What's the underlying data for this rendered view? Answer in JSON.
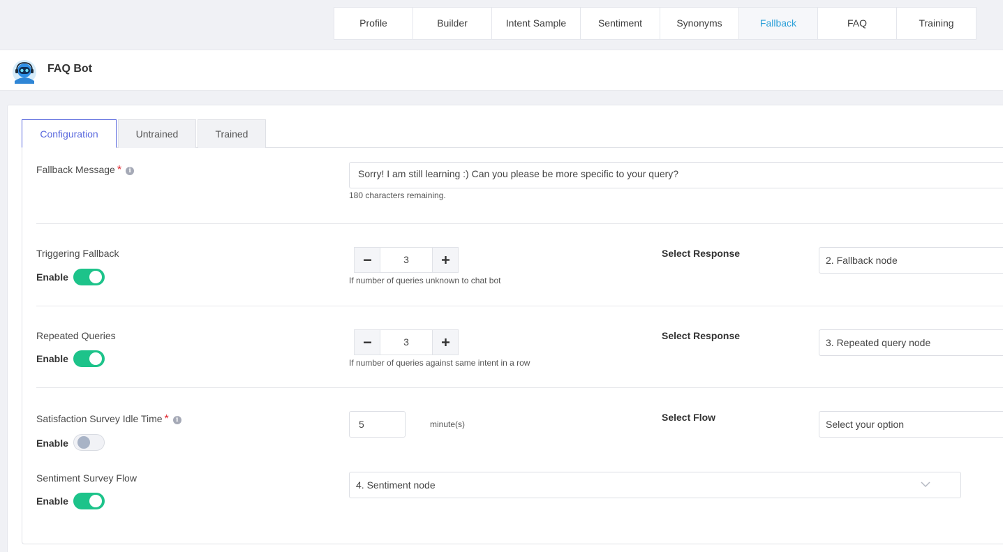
{
  "top_nav": {
    "tabs": [
      "Profile",
      "Builder",
      "Intent Sample",
      "Sentiment",
      "Synonyms",
      "Fallback",
      "FAQ",
      "Training"
    ],
    "active": "Fallback"
  },
  "header": {
    "title": "FAQ Bot",
    "avatar_icon": "robot-headset-avatar"
  },
  "sub_tabs": {
    "tabs": [
      "Configuration",
      "Untrained",
      "Trained"
    ],
    "active": "Configuration"
  },
  "fallback_message": {
    "label": "Fallback Message",
    "required_mark": "*",
    "value": "Sorry! I am still learning :) Can you please be more specific to your query?",
    "remaining": "180 characters remaining."
  },
  "triggering_fallback": {
    "label": "Triggering Fallback",
    "enable_label": "Enable",
    "enabled": true,
    "count": "3",
    "hint": "If number of queries unknown to chat bot",
    "response_label": "Select Response",
    "response_value": "2. Fallback node"
  },
  "repeated_queries": {
    "label": "Repeated Queries",
    "enable_label": "Enable",
    "enabled": true,
    "count": "3",
    "hint": "If number of queries against same intent in a row",
    "response_label": "Select Response",
    "response_value": "3. Repeated query node"
  },
  "survey_idle": {
    "label": "Satisfaction Survey Idle Time",
    "required_mark": "*",
    "enable_label": "Enable",
    "enabled": false,
    "value": "5",
    "unit": "minute(s)",
    "flow_label": "Select Flow",
    "flow_placeholder": "Select your option"
  },
  "sentiment_flow": {
    "label": "Sentiment Survey Flow",
    "enable_label": "Enable",
    "enabled": true,
    "value": "4. Sentiment node"
  },
  "colors": {
    "toggle_on": "#1dc38a",
    "active_tab": "#2a9fd8",
    "active_subtab": "#5867dd",
    "required": "#e0262e"
  }
}
